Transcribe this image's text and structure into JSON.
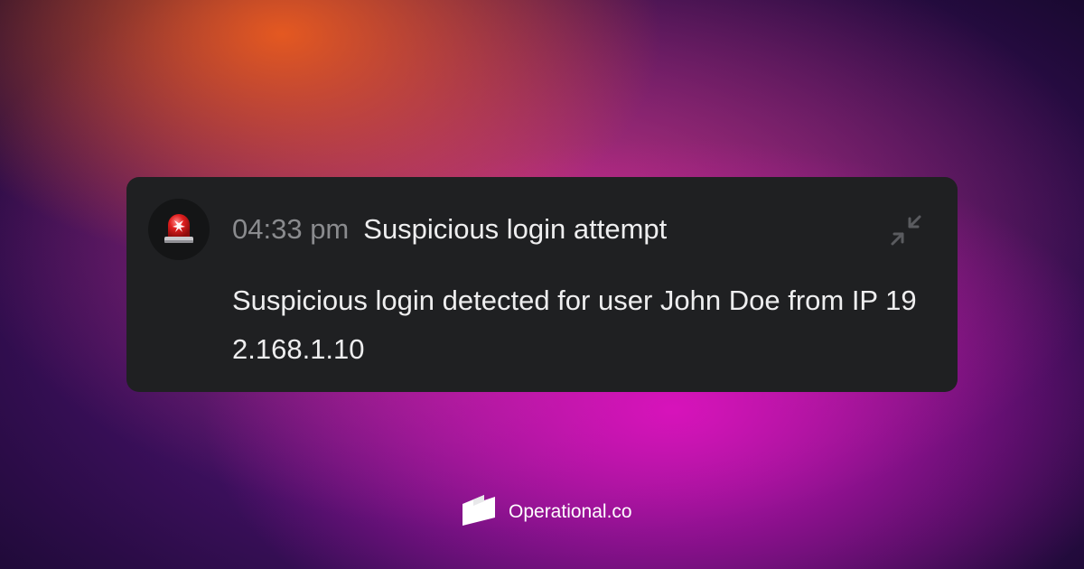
{
  "notification": {
    "icon": "siren-icon",
    "time": "04:33 pm",
    "title": "Suspicious login attempt",
    "message": "Suspicious login detected for user John Doe from IP 192.168.1.10",
    "collapse_icon": "collapse-icon"
  },
  "footer": {
    "logo_icon": "operational-logo-icon",
    "brand": "Operational.co"
  },
  "colors": {
    "card_background": "#1f2022",
    "avatar_background": "#141516",
    "text_primary": "#eeeeef",
    "text_muted": "#8a8b8e",
    "siren_red": "#e01e1e"
  }
}
